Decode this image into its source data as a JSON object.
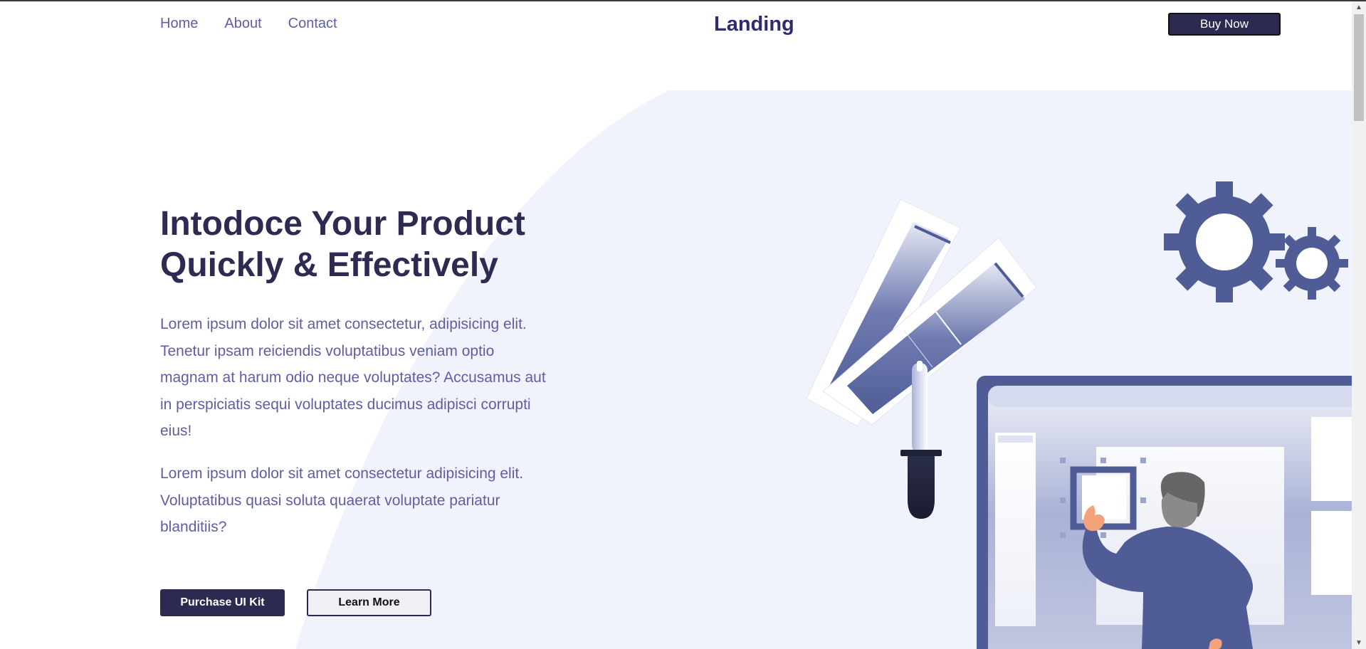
{
  "header": {
    "nav": [
      "Home",
      "About",
      "Contact"
    ],
    "brand": "Landing",
    "buy_label": "Buy Now"
  },
  "hero": {
    "title_line1": "Intodoce Your Product",
    "title_line2": "Quickly & Effectively",
    "paragraph1": "Lorem ipsum dolor sit amet consectetur, adipisicing elit. Tenetur ipsam reiciendis voluptatibus veniam optio magnam at harum odio neque voluptates? Accusamus aut in perspiciatis sequi voluptates ducimus adipisci corrupti eius!",
    "paragraph2": "Lorem ipsum dolor sit amet consectetur adipisicing elit. Voluptatibus quasi soluta quaerat voluptate pariatur blanditiis?",
    "primary_label": "Purchase UI Kit",
    "secondary_label": "Learn More"
  },
  "colors": {
    "dark": "#2c2a50",
    "accent": "#4f5c96",
    "text": "#5c5fa3",
    "hero_bg": "#f0f3fc"
  }
}
